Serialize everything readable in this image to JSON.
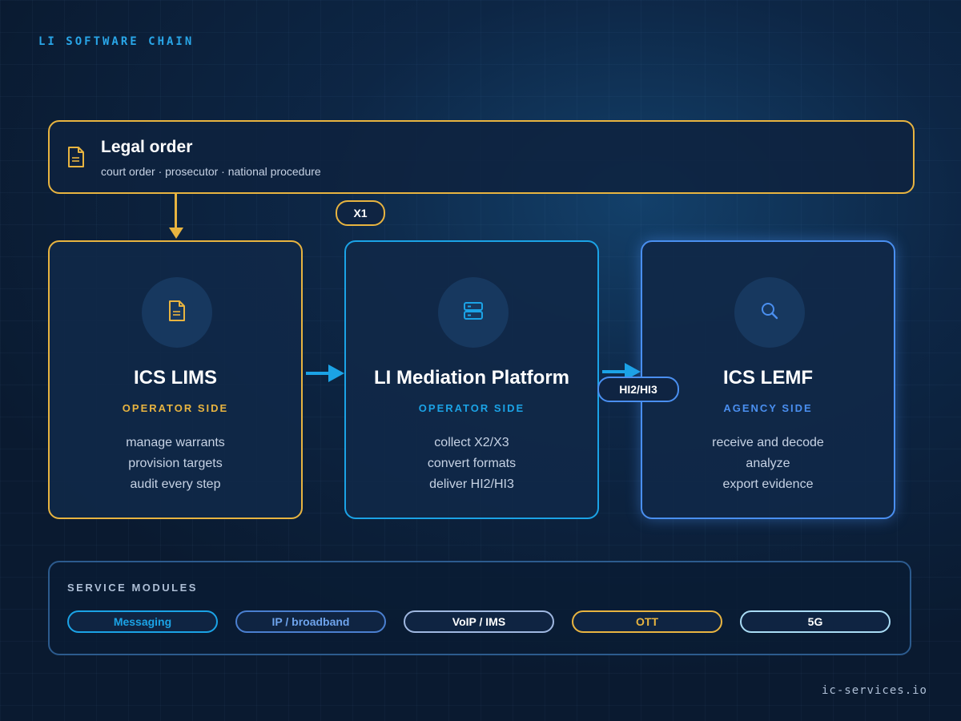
{
  "header": {
    "eyebrow": "LI SOFTWARE CHAIN"
  },
  "legal_order": {
    "title": "Legal order",
    "subtitle": "court order · prosecutor · national procedure",
    "icon": "document-icon",
    "color": "#e8b440"
  },
  "links": {
    "x1_label": "X1",
    "hi_label": "HI2/HI3"
  },
  "cards": [
    {
      "title": "ICS LIMS",
      "side": "OPERATOR SIDE",
      "icon": "document-icon",
      "color": "#e8b440",
      "lines": [
        "manage warrants",
        "provision targets",
        "audit every step"
      ]
    },
    {
      "title": "LI Mediation Platform",
      "side": "OPERATOR SIDE",
      "icon": "server-icon",
      "color": "#1ba3e6",
      "lines": [
        "collect X2/X3",
        "convert formats",
        "deliver HI2/HI3"
      ]
    },
    {
      "title": "ICS LEMF",
      "side": "AGENCY SIDE",
      "icon": "search-icon",
      "color": "#4a8ff0",
      "lines": [
        "receive and decode",
        "analyze",
        "export evidence"
      ]
    }
  ],
  "modules": {
    "title": "SERVICE MODULES",
    "items": [
      "Messaging",
      "IP / broadband",
      "VoIP / IMS",
      "OTT",
      "5G"
    ]
  },
  "footer": {
    "site": "ic-services.io"
  }
}
